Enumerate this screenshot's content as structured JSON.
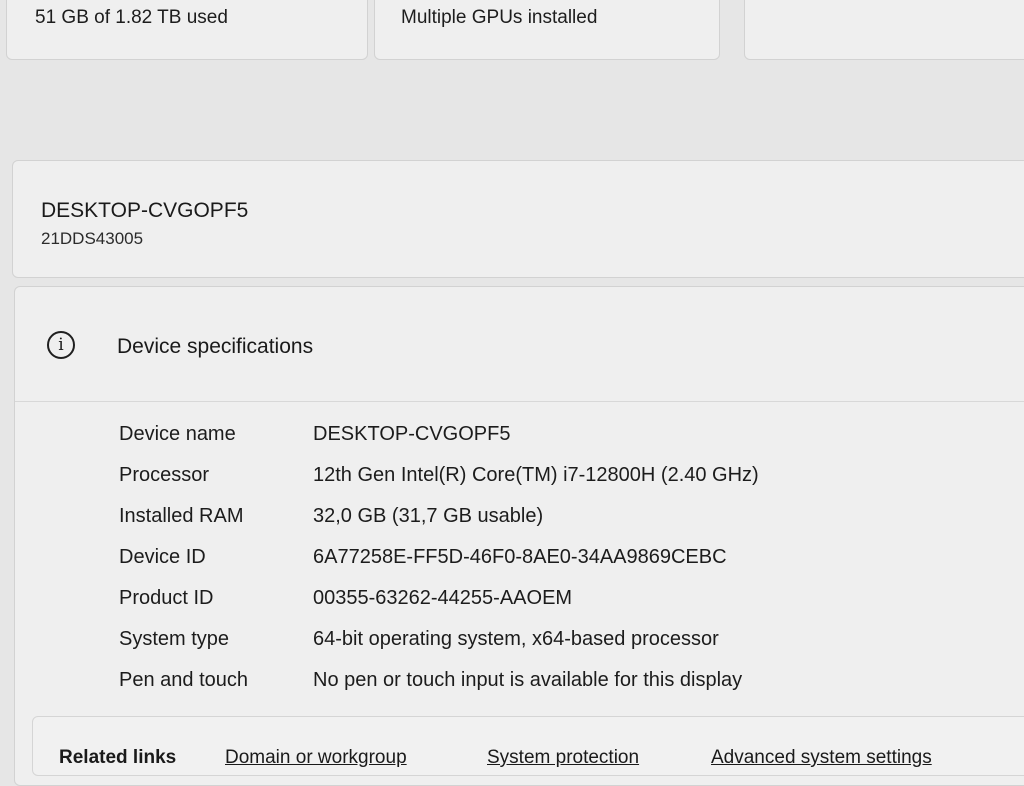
{
  "top_cards": {
    "storage": "51 GB of 1.82 TB used",
    "graphics": "Multiple GPUs installed"
  },
  "device": {
    "name": "DESKTOP-CVGOPF5",
    "model": "21DDS43005"
  },
  "specs": {
    "title": "Device specifications",
    "icon": "info-icon",
    "rows": [
      {
        "label": "Device name",
        "value": "DESKTOP-CVGOPF5"
      },
      {
        "label": "Processor",
        "value": "12th Gen Intel(R) Core(TM) i7-12800H (2.40 GHz)"
      },
      {
        "label": "Installed RAM",
        "value": "32,0 GB (31,7 GB usable)"
      },
      {
        "label": "Device ID",
        "value": "6A77258E-FF5D-46F0-8AE0-34AA9869CEBC"
      },
      {
        "label": "Product ID",
        "value": "00355-63262-44255-AAOEM"
      },
      {
        "label": "System type",
        "value": "64-bit operating system, x64-based processor"
      },
      {
        "label": "Pen and touch",
        "value": "No pen or touch input is available for this display"
      }
    ]
  },
  "related": {
    "title": "Related links",
    "links": [
      "Domain or workgroup",
      "System protection",
      "Advanced system settings"
    ]
  }
}
